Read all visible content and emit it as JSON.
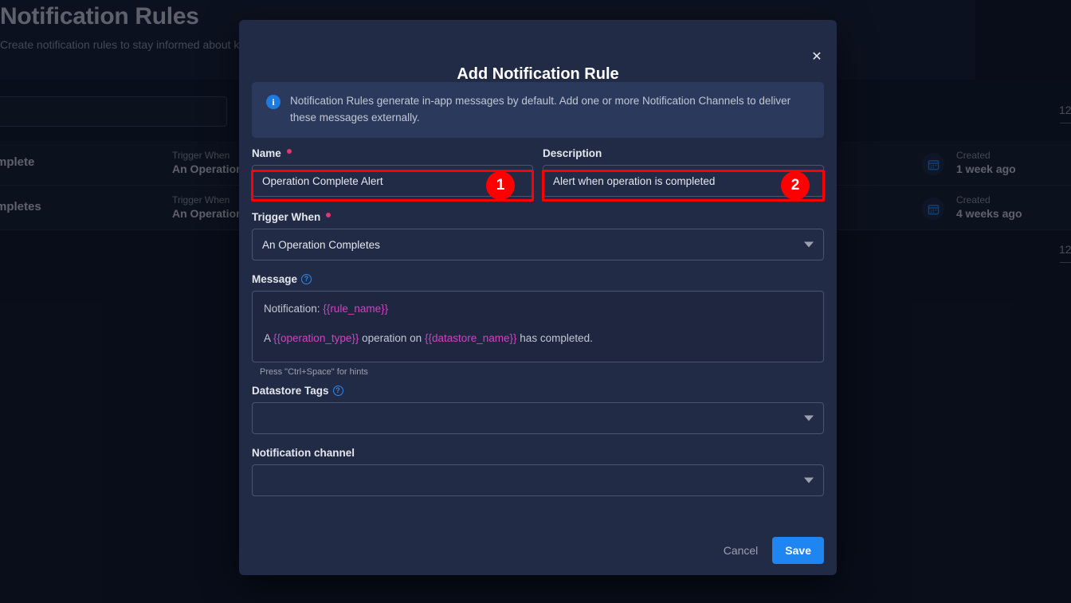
{
  "background": {
    "page_title": "Notification Rules",
    "page_subtitle": "Create notification rules to stay informed about key events",
    "search_placeholder": "",
    "count_badge_top": "12",
    "count_badge_bottom": "12",
    "rules": [
      {
        "name": "Operation Complete",
        "trigger_label": "Trigger When",
        "trigger_value": "An Operation Completes",
        "created_label": "Created",
        "created_value": "1 week ago",
        "calendar_icon": "calendar-icon"
      },
      {
        "name": "Operation Completes",
        "trigger_label": "Trigger When",
        "trigger_value": "An Operation Completes",
        "created_label": "Created",
        "created_value": "4 weeks ago",
        "calendar_icon": "calendar-icon"
      }
    ]
  },
  "modal": {
    "title": "Add Notification Rule",
    "close_icon": "close-icon",
    "info": {
      "icon": "info-icon",
      "text": "Notification Rules generate in-app messages by default. Add one or more Notification Channels to deliver these messages externally."
    },
    "fields": {
      "name": {
        "label": "Name",
        "required": true,
        "value": "Operation Complete Alert",
        "placeholder": ""
      },
      "description": {
        "label": "Description",
        "required": false,
        "value": "Alert when operation is completed",
        "placeholder": ""
      },
      "trigger_when": {
        "label": "Trigger When",
        "required": true,
        "value": "An Operation Completes",
        "caret_icon": "chevron-down-icon"
      },
      "message": {
        "label": "Message",
        "help_icon": "question-mark-icon",
        "line1_prefix": "Notification: ",
        "line1_var": "{{rule_name}}",
        "line2_a": "A ",
        "line2_var1": "{{operation_type}}",
        "line2_b": " operation on ",
        "line2_var2": "{{datastore_name}}",
        "line2_c": " has completed.",
        "hint": "Press \"Ctrl+Space\" for hints"
      },
      "datastore_tags": {
        "label": "Datastore Tags",
        "help_icon": "question-mark-icon",
        "value": "",
        "caret_icon": "chevron-down-icon"
      },
      "notification_channel": {
        "label": "Notification channel",
        "value": "",
        "caret_icon": "chevron-down-icon"
      }
    },
    "buttons": {
      "cancel": "Cancel",
      "save": "Save"
    }
  },
  "annotations": [
    {
      "number": "1",
      "target": "name-field"
    },
    {
      "number": "2",
      "target": "description-field"
    }
  ],
  "colors": {
    "accent_blue": "#1f85f0",
    "annotation_red": "#ff0000",
    "required_pink": "#e8336d",
    "template_var": "#d341c4",
    "modal_bg": "#222b45",
    "page_bg": "#0d1321"
  }
}
